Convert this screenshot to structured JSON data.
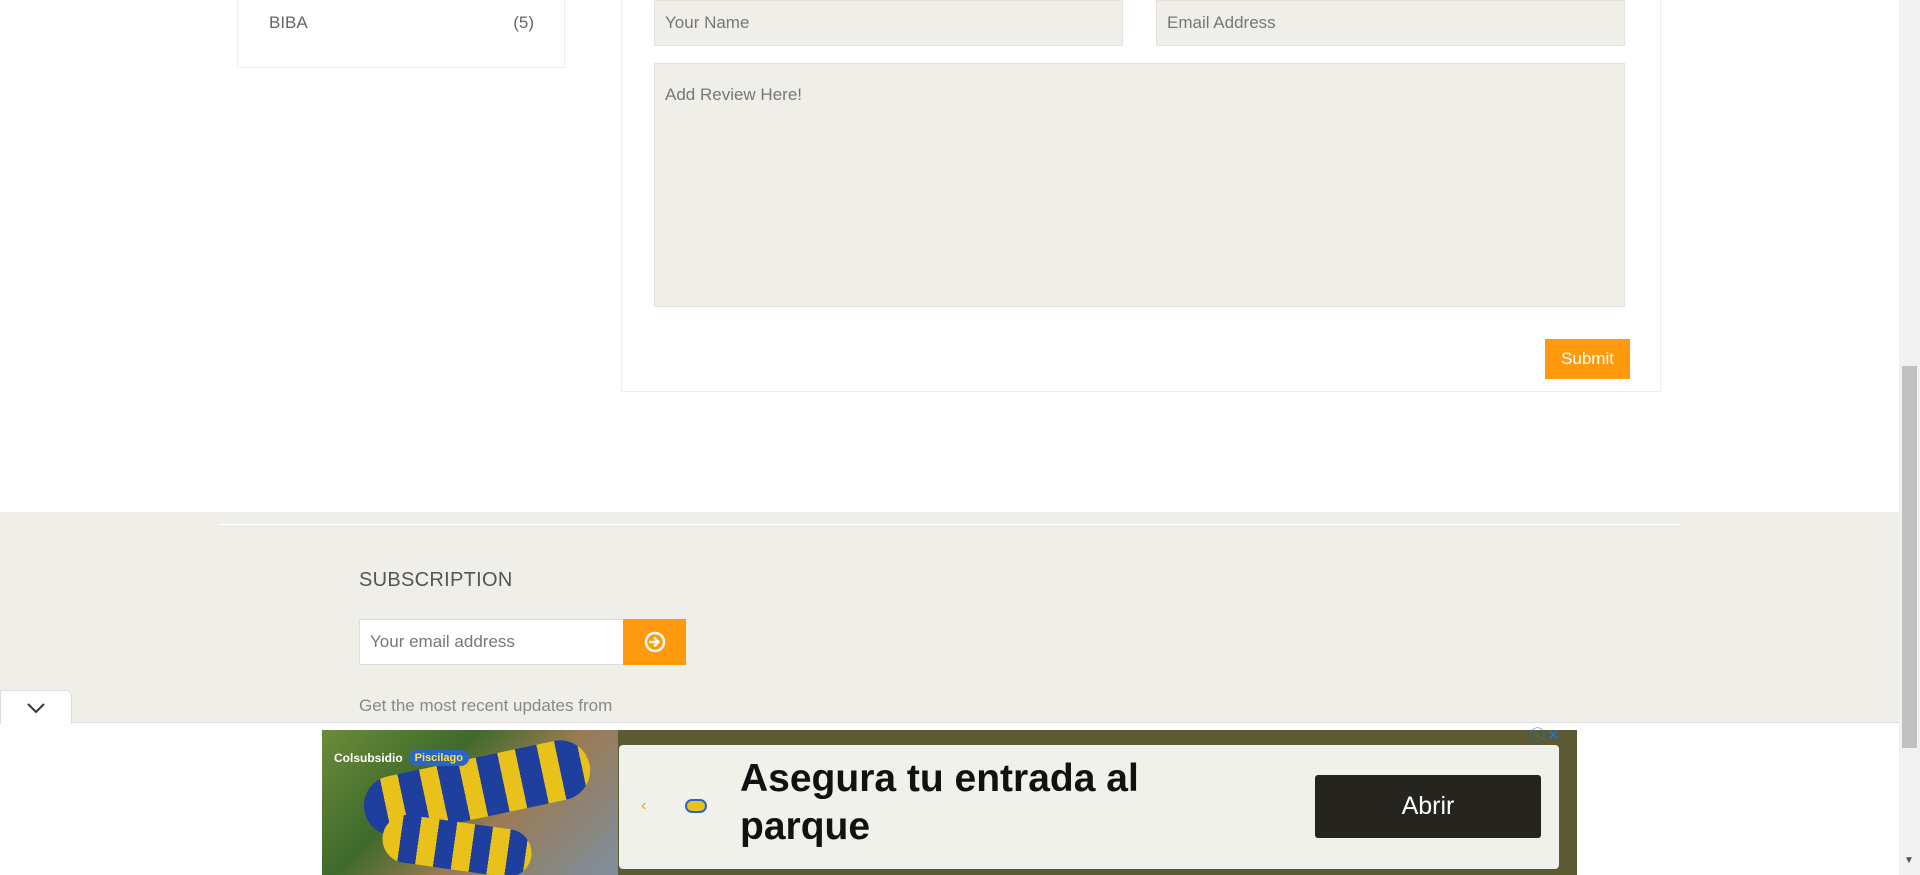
{
  "sidebar": {
    "brand": {
      "name": "BIBA",
      "count": "(5)"
    }
  },
  "review_form": {
    "name_placeholder": "Your Name",
    "email_placeholder": "Email Address",
    "review_placeholder": "Add Review Here!",
    "submit_label": "Submit"
  },
  "footer": {
    "subscription_title": "SUBSCRIPTION",
    "email_placeholder": "Your email address",
    "updates_text": "Get the most recent updates from"
  },
  "ad": {
    "logo_text": "Colsubsidio",
    "logo_badge": "Piscilago",
    "headline": "Asegura tu entrada al parque",
    "cta_label": "Abrir",
    "info_icon": "ⓘ",
    "close_icon": "✕"
  },
  "colors": {
    "accent": "#ff9a0f",
    "footer_bg": "#efeee8",
    "ad_bg": "#5b5a32",
    "ad_button": "#25241f"
  }
}
